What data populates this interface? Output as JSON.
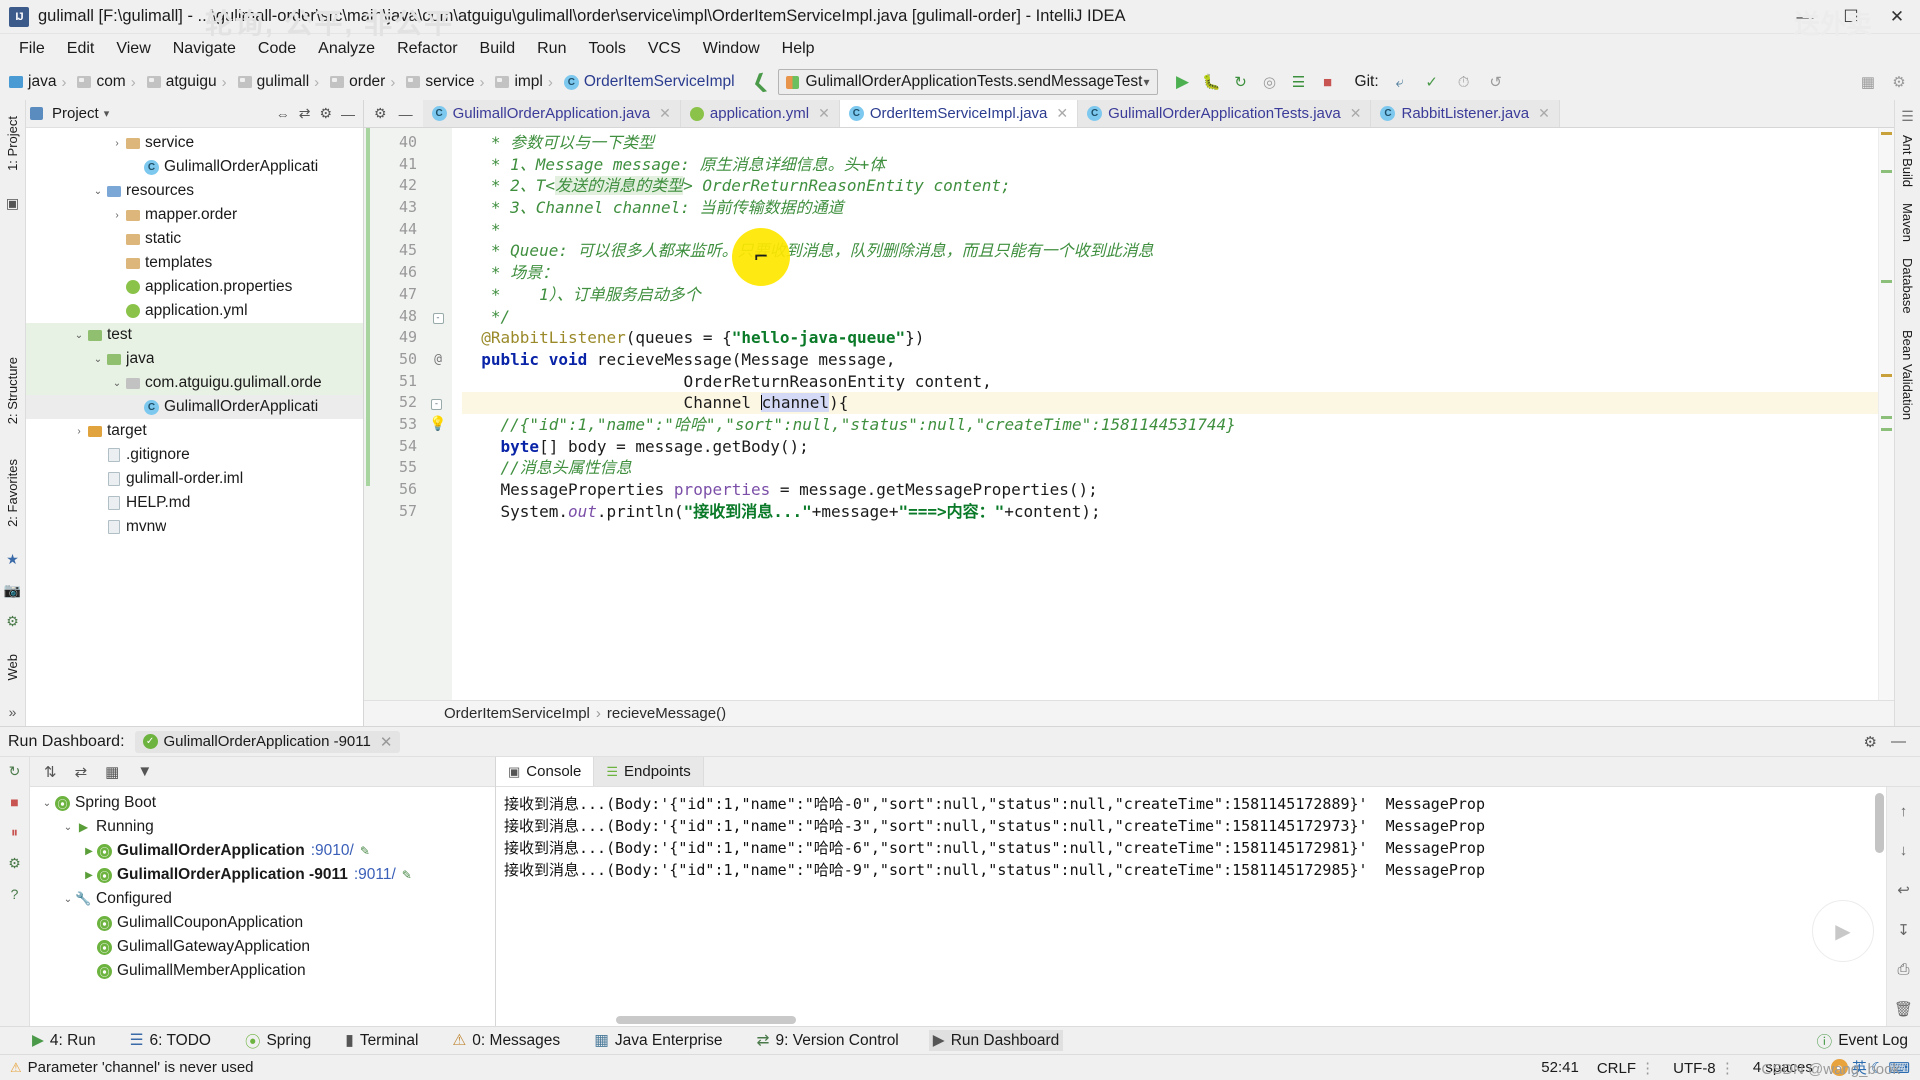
{
  "window": {
    "title": "gulimall [F:\\gulimall] - ...\\gulimall-order\\src\\main\\java\\com\\atguigu\\gulimall\\order\\service\\impl\\OrderItemServiceImpl.java [gulimall-order] - IntelliJ IDEA",
    "app_icon": "IJ",
    "minimize": "—",
    "maximize": "☐",
    "close": "✕"
  },
  "watermarks": {
    "top": "轮询, 公平, 非公平",
    "right": "送外卖",
    "bottom": "CSDN @wang_book"
  },
  "menu": [
    {
      "label": "File"
    },
    {
      "label": "Edit"
    },
    {
      "label": "View"
    },
    {
      "label": "Navigate"
    },
    {
      "label": "Code"
    },
    {
      "label": "Analyze"
    },
    {
      "label": "Refactor"
    },
    {
      "label": "Build"
    },
    {
      "label": "Run"
    },
    {
      "label": "Tools"
    },
    {
      "label": "VCS"
    },
    {
      "label": "Window"
    },
    {
      "label": "Help"
    }
  ],
  "navbar": {
    "breadcrumbs": [
      {
        "label": "java",
        "icon": "source-folder-icon"
      },
      {
        "label": "com",
        "icon": "folder-icon"
      },
      {
        "label": "atguigu",
        "icon": "folder-icon"
      },
      {
        "label": "gulimall",
        "icon": "folder-icon"
      },
      {
        "label": "order",
        "icon": "folder-icon"
      },
      {
        "label": "service",
        "icon": "folder-icon"
      },
      {
        "label": "impl",
        "icon": "folder-icon"
      },
      {
        "label": "OrderItemServiceImpl",
        "icon": "class-icon"
      }
    ],
    "run_config": "GulimallOrderApplicationTests.sendMessageTest",
    "git_label": "Git:",
    "actions": [
      "run-icon",
      "debug-icon",
      "run-with-coverage-icon",
      "profile-icon",
      "stop-icon"
    ]
  },
  "left_rail": {
    "project_label": "1: Project",
    "structure_label": "2: Structure",
    "favorites_label": "2: Favorites",
    "web_label": "Web"
  },
  "right_rail": {
    "items": [
      "Ant Build",
      "Maven",
      "Database",
      "Bean Validation"
    ]
  },
  "project_panel": {
    "title": "Project",
    "tree": [
      {
        "depth": 4,
        "twisty": "›",
        "icon": "folder-icon",
        "label": "service",
        "state": "normal"
      },
      {
        "depth": 5,
        "twisty": "",
        "icon": "class-icon",
        "label": "GulimallOrderApplicati",
        "state": "normal"
      },
      {
        "depth": 3,
        "twisty": "⌄",
        "icon": "resources-folder-icon",
        "label": "resources",
        "state": "normal"
      },
      {
        "depth": 4,
        "twisty": "›",
        "icon": "folder-icon",
        "label": "mapper.order",
        "state": "normal"
      },
      {
        "depth": 4,
        "twisty": "",
        "icon": "folder-icon",
        "label": "static",
        "state": "normal"
      },
      {
        "depth": 4,
        "twisty": "",
        "icon": "folder-icon",
        "label": "templates",
        "state": "normal"
      },
      {
        "depth": 4,
        "twisty": "",
        "icon": "properties-icon",
        "label": "application.properties",
        "state": "normal"
      },
      {
        "depth": 4,
        "twisty": "",
        "icon": "yml-icon",
        "label": "application.yml",
        "state": "normal"
      },
      {
        "depth": 2,
        "twisty": "⌄",
        "icon": "test-folder-icon",
        "label": "test",
        "state": "green"
      },
      {
        "depth": 3,
        "twisty": "⌄",
        "icon": "test-folder-icon",
        "label": "java",
        "state": "green"
      },
      {
        "depth": 4,
        "twisty": "⌄",
        "icon": "package-icon",
        "label": "com.atguigu.gulimall.orde",
        "state": "green"
      },
      {
        "depth": 5,
        "twisty": "",
        "icon": "class-icon",
        "label": "GulimallOrderApplicati",
        "state": "grey"
      },
      {
        "depth": 2,
        "twisty": "›",
        "icon": "target-folder-icon",
        "label": "target",
        "state": "normal"
      },
      {
        "depth": 3,
        "twisty": "",
        "icon": "file-icon",
        "label": ".gitignore",
        "state": "normal"
      },
      {
        "depth": 3,
        "twisty": "",
        "icon": "file-icon",
        "label": "gulimall-order.iml",
        "state": "normal"
      },
      {
        "depth": 3,
        "twisty": "",
        "icon": "md-icon",
        "label": "HELP.md",
        "state": "normal"
      },
      {
        "depth": 3,
        "twisty": "",
        "icon": "file-icon",
        "label": "mvnw",
        "state": "normal"
      }
    ]
  },
  "editor_tabs": [
    {
      "label": "GulimallOrderApplication.java",
      "icon": "spring-class-icon",
      "active": false,
      "closable": true
    },
    {
      "label": "application.yml",
      "icon": "yml-icon",
      "active": false,
      "closable": true
    },
    {
      "label": "OrderItemServiceImpl.java",
      "icon": "class-icon",
      "active": true,
      "closable": true
    },
    {
      "label": "GulimallOrderApplicationTests.java",
      "icon": "test-class-icon",
      "active": false,
      "closable": true
    },
    {
      "label": "RabbitListener.java",
      "icon": "lib-class-icon",
      "active": false,
      "closable": true
    }
  ],
  "editor": {
    "first_line_number": 40,
    "lines": [
      {
        "n": 40,
        "gutter": "",
        "segments": [
          {
            "t": "   * 参数可以与一下类型",
            "c": "cm"
          }
        ]
      },
      {
        "n": 41,
        "gutter": "",
        "segments": [
          {
            "t": "   * 1、Message message",
            "c": "cm"
          },
          {
            "t": ": 原生消息详细信息。头+体",
            "c": "cm"
          }
        ]
      },
      {
        "n": 42,
        "gutter": "",
        "segments": [
          {
            "t": "   * 2、T<",
            "c": "cm"
          },
          {
            "t": "发送的消息的类型",
            "c": "cmh"
          },
          {
            "t": "> OrderReturnReasonEntity content;",
            "c": "cm"
          }
        ]
      },
      {
        "n": 43,
        "gutter": "",
        "segments": [
          {
            "t": "   * 3、Channel channel: 当前传输数据的通道",
            "c": "cm"
          }
        ]
      },
      {
        "n": 44,
        "gutter": "",
        "segments": [
          {
            "t": "   *",
            "c": "cm"
          }
        ]
      },
      {
        "n": 45,
        "gutter": "",
        "segments": [
          {
            "t": "   * Queue: 可以很多人都来监听。只要收到消息，队列删除消息，而且只能有一个收到此消息",
            "c": "cm"
          }
        ]
      },
      {
        "n": 46,
        "gutter": "",
        "segments": [
          {
            "t": "   * 场景：",
            "c": "cm"
          }
        ]
      },
      {
        "n": 47,
        "gutter": "",
        "segments": [
          {
            "t": "   *    1）、订单服务启动多个",
            "c": "cm"
          }
        ]
      },
      {
        "n": 48,
        "gutter": "fold",
        "segments": [
          {
            "t": "   */",
            "c": "cm"
          }
        ]
      },
      {
        "n": 49,
        "gutter": "",
        "segments": [
          {
            "t": "  @RabbitListener",
            "c": "ann"
          },
          {
            "t": "(queues = {",
            "c": ""
          },
          {
            "t": "\"hello-java-queue\"",
            "c": "str"
          },
          {
            "t": "})",
            "c": ""
          }
        ]
      },
      {
        "n": 50,
        "gutter": "@",
        "segments": [
          {
            "t": "  public void ",
            "c": "kw"
          },
          {
            "t": "recieveMessage(Message message,",
            "c": ""
          }
        ]
      },
      {
        "n": 51,
        "gutter": "",
        "segments": [
          {
            "t": "                       OrderReturnReasonEntity content,",
            "c": ""
          }
        ]
      },
      {
        "n": 52,
        "gutter": "bulb",
        "segments": [
          {
            "t": "                       Channel ",
            "c": ""
          },
          {
            "t": "channel",
            "c": "caret"
          },
          {
            "t": "){",
            "c": ""
          }
        ],
        "highlight": true
      },
      {
        "n": 53,
        "gutter": "",
        "segments": [
          {
            "t": "    //{\"id\":1,\"name\":\"哈哈\",\"sort\":null,\"status\":null,\"createTime\":1581144531744}",
            "c": "cm"
          }
        ]
      },
      {
        "n": 54,
        "gutter": "",
        "segments": [
          {
            "t": "    byte",
            "c": "kw"
          },
          {
            "t": "[] body = message.getBody();",
            "c": ""
          }
        ]
      },
      {
        "n": 55,
        "gutter": "",
        "segments": [
          {
            "t": "    //消息头属性信息",
            "c": "cm"
          }
        ]
      },
      {
        "n": 56,
        "gutter": "",
        "segments": [
          {
            "t": "    MessageProperties ",
            "c": ""
          },
          {
            "t": "properties",
            "c": "fld"
          },
          {
            "t": " = message.getMessageProperties();",
            "c": ""
          }
        ]
      },
      {
        "n": 57,
        "gutter": "",
        "segments": [
          {
            "t": "    System.",
            "c": ""
          },
          {
            "t": "out",
            "c": "fldi"
          },
          {
            "t": ".println(",
            "c": ""
          },
          {
            "t": "\"接收到消息...\"",
            "c": "str"
          },
          {
            "t": "+message+",
            "c": ""
          },
          {
            "t": "\"===>内容：\"",
            "c": "str"
          },
          {
            "t": "+content);",
            "c": ""
          }
        ]
      }
    ],
    "breadcrumb": [
      "OrderItemServiceImpl",
      "recieveMessage()"
    ],
    "caret_word": "channel"
  },
  "run_dashboard": {
    "header_title": "Run Dashboard:",
    "chip_label": "GulimallOrderApplication -9011",
    "chip_close": "✕",
    "tree": [
      {
        "depth": 0,
        "twisty": "⌄",
        "icon": "spring-icon",
        "label": "Spring Boot",
        "bold": false
      },
      {
        "depth": 1,
        "twisty": "⌄",
        "icon": "run-icon",
        "label": "Running",
        "bold": false
      },
      {
        "depth": 2,
        "twisty": "▶",
        "icon": "spring-icon",
        "label": "GulimallOrderApplication",
        "suffix": ":9010/",
        "bold": true
      },
      {
        "depth": 2,
        "twisty": "▶",
        "icon": "spring-icon",
        "label": "GulimallOrderApplication -9011",
        "suffix": ":9011/",
        "bold": true
      },
      {
        "depth": 1,
        "twisty": "⌄",
        "icon": "wrench-icon",
        "label": "Configured",
        "bold": false
      },
      {
        "depth": 2,
        "twisty": "",
        "icon": "spring-icon",
        "label": "GulimallCouponApplication",
        "bold": false
      },
      {
        "depth": 2,
        "twisty": "",
        "icon": "spring-icon",
        "label": "GulimallGatewayApplication",
        "bold": false
      },
      {
        "depth": 2,
        "twisty": "",
        "icon": "spring-icon",
        "label": "GulimallMemberApplication",
        "bold": false
      }
    ],
    "console_tabs": [
      {
        "label": "Console",
        "icon": "console-icon",
        "active": true
      },
      {
        "label": "Endpoints",
        "icon": "endpoints-icon",
        "active": false
      }
    ],
    "console_lines": [
      "接收到消息...(Body:'{\"id\":1,\"name\":\"哈哈-0\",\"sort\":null,\"status\":null,\"createTime\":1581145172889}'  MessageProp",
      "接收到消息...(Body:'{\"id\":1,\"name\":\"哈哈-3\",\"sort\":null,\"status\":null,\"createTime\":1581145172973}'  MessageProp",
      "接收到消息...(Body:'{\"id\":1,\"name\":\"哈哈-6\",\"sort\":null,\"status\":null,\"createTime\":1581145172981}'  MessageProp",
      "接收到消息...(Body:'{\"id\":1,\"name\":\"哈哈-9\",\"sort\":null,\"status\":null,\"createTime\":1581145172985}'  MessageProp"
    ]
  },
  "toolwindow_bar": [
    {
      "label": "4: Run",
      "icon": "run-icon",
      "active": false
    },
    {
      "label": "6: TODO",
      "icon": "todo-icon",
      "active": false
    },
    {
      "label": "Spring",
      "icon": "spring-icon",
      "active": false
    },
    {
      "label": "Terminal",
      "icon": "terminal-icon",
      "active": false
    },
    {
      "label": "0: Messages",
      "icon": "messages-icon",
      "active": false
    },
    {
      "label": "Java Enterprise",
      "icon": "jee-icon",
      "active": false
    },
    {
      "label": "9: Version Control",
      "icon": "vcs-icon",
      "active": false
    },
    {
      "label": "Run Dashboard",
      "icon": "dashboard-icon",
      "active": true
    }
  ],
  "event_log": "Event Log",
  "statusbar": {
    "message": "Parameter 'channel' is never used",
    "caret_position": "52:41",
    "line_separator": "CRLF",
    "encoding": "UTF-8",
    "indent": "4 spaces",
    "ime_label": "英"
  }
}
